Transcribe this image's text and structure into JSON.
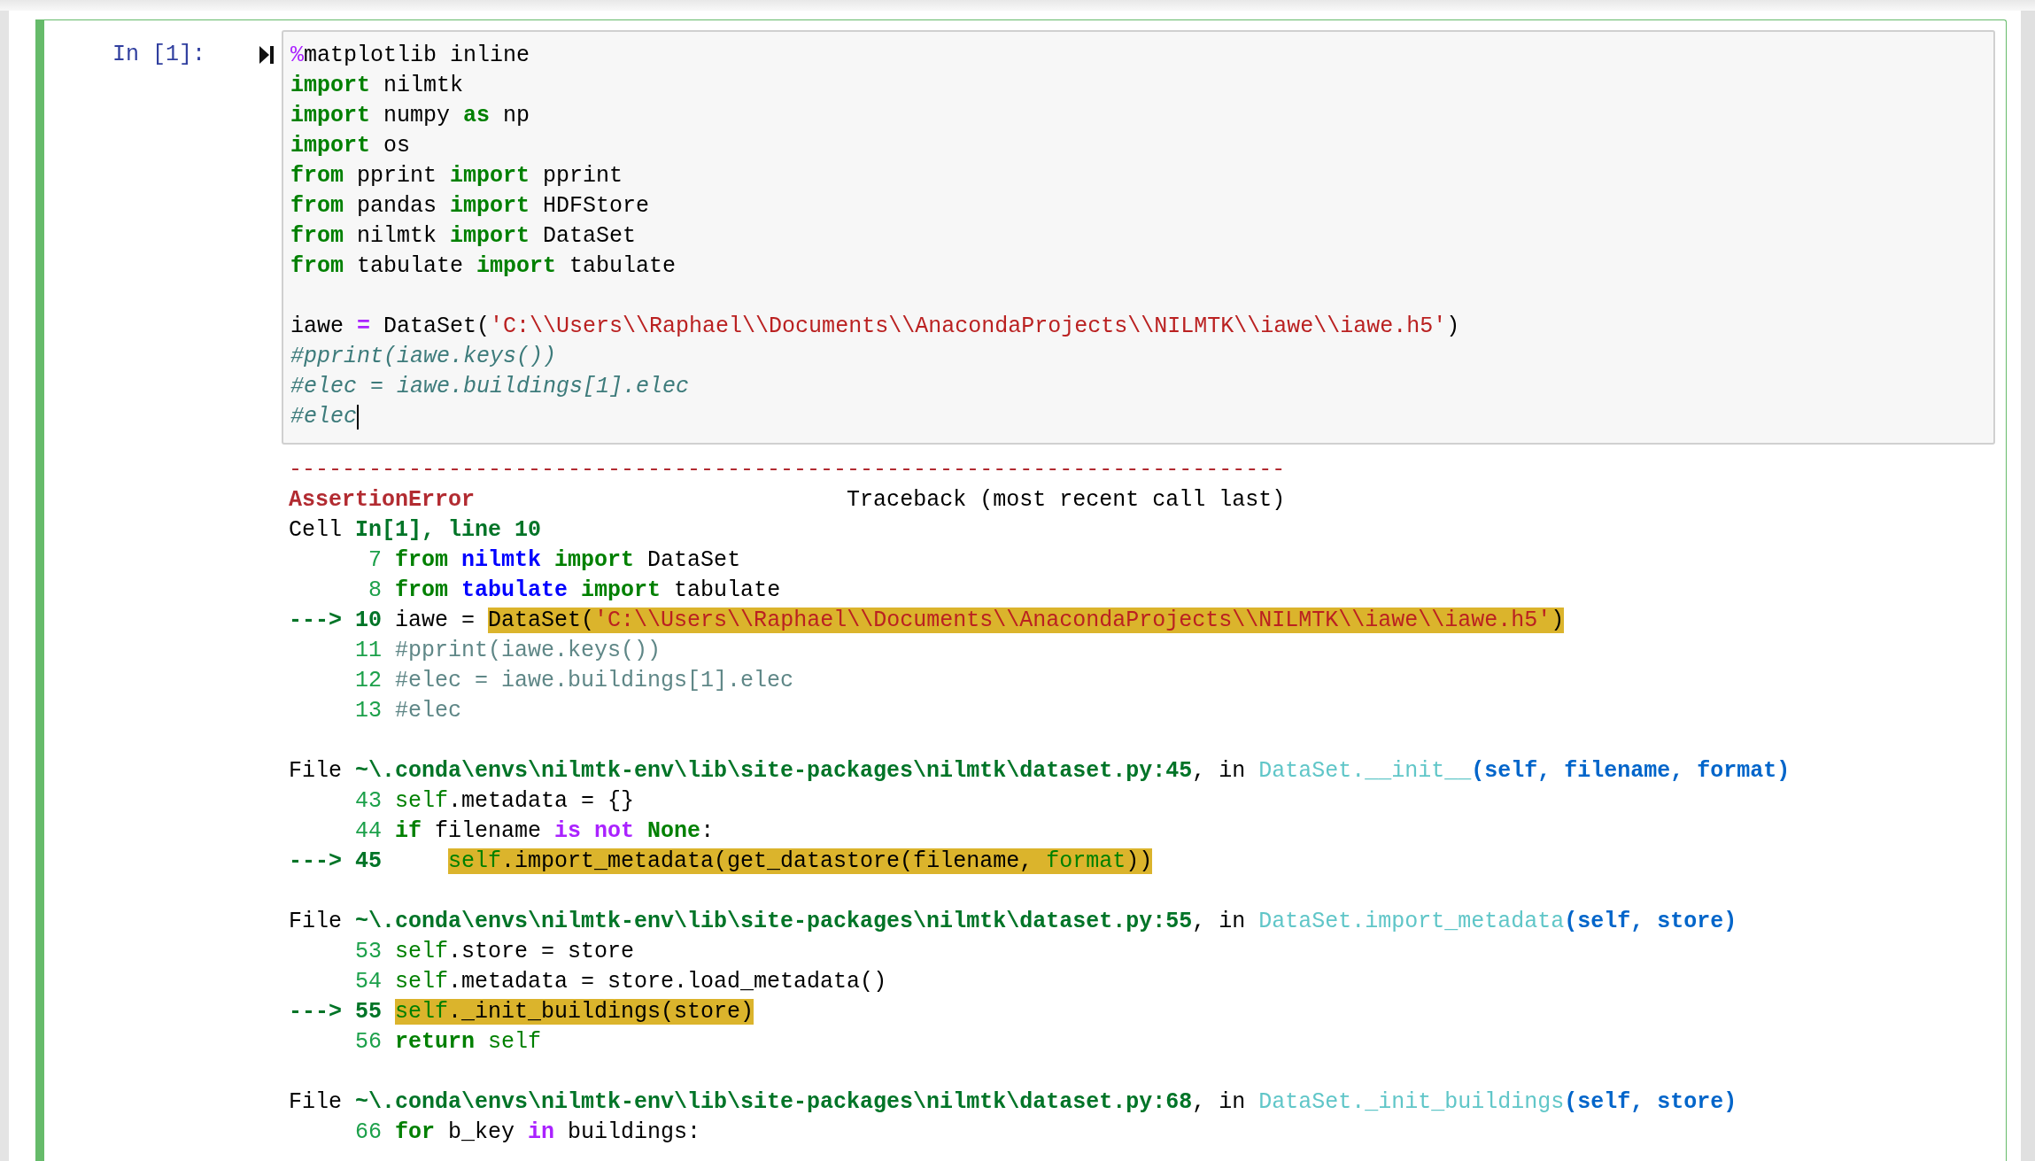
{
  "cell": {
    "prompt": "In [1]:",
    "input": {
      "blocks": [
        {
          "lines": [
            {
              "tokens": [
                {
                  "text": "%",
                  "kind": "magic"
                },
                {
                  "text": "matplotlib inline",
                  "kind": "plain"
                }
              ]
            },
            {
              "tokens": [
                {
                  "text": "import",
                  "kind": "kw"
                },
                {
                  "text": " nilmtk",
                  "kind": "plain"
                }
              ]
            },
            {
              "tokens": [
                {
                  "text": "import",
                  "kind": "kw"
                },
                {
                  "text": " numpy ",
                  "kind": "plain"
                },
                {
                  "text": "as",
                  "kind": "kw"
                },
                {
                  "text": " np",
                  "kind": "plain"
                }
              ]
            },
            {
              "tokens": [
                {
                  "text": "import",
                  "kind": "kw"
                },
                {
                  "text": " os",
                  "kind": "plain"
                }
              ]
            },
            {
              "tokens": [
                {
                  "text": "from",
                  "kind": "kw"
                },
                {
                  "text": " pprint ",
                  "kind": "plain"
                },
                {
                  "text": "import",
                  "kind": "kw"
                },
                {
                  "text": " pprint",
                  "kind": "plain"
                }
              ]
            },
            {
              "tokens": [
                {
                  "text": "from",
                  "kind": "kw"
                },
                {
                  "text": " pandas ",
                  "kind": "plain"
                },
                {
                  "text": "import",
                  "kind": "kw"
                },
                {
                  "text": " HDFStore",
                  "kind": "plain"
                }
              ]
            },
            {
              "tokens": [
                {
                  "text": "from",
                  "kind": "kw"
                },
                {
                  "text": " nilmtk ",
                  "kind": "plain"
                },
                {
                  "text": "import",
                  "kind": "kw"
                },
                {
                  "text": " DataSet",
                  "kind": "plain"
                }
              ]
            },
            {
              "tokens": [
                {
                  "text": "from",
                  "kind": "kw"
                },
                {
                  "text": " tabulate ",
                  "kind": "plain"
                },
                {
                  "text": "import",
                  "kind": "kw"
                },
                {
                  "text": " tabulate",
                  "kind": "plain"
                }
              ]
            }
          ]
        },
        {
          "lines": [
            {
              "tokens": [
                {
                  "text": "iawe ",
                  "kind": "plain"
                },
                {
                  "text": "=",
                  "kind": "op"
                },
                {
                  "text": " DataSet(",
                  "kind": "plain"
                },
                {
                  "text": "'C:\\\\Users\\\\Raphael\\\\Documents\\\\AnacondaProjects\\\\NILMTK\\\\iawe\\\\iawe.h5'",
                  "kind": "str"
                },
                {
                  "text": ")",
                  "kind": "plain"
                }
              ]
            },
            {
              "tokens": [
                {
                  "text": "#pprint(iawe.keys())",
                  "kind": "comment"
                }
              ]
            },
            {
              "tokens": [
                {
                  "text": "#elec = iawe.buildings[1].elec",
                  "kind": "comment"
                }
              ]
            },
            {
              "tokens": [
                {
                  "text": "#elec",
                  "kind": "comment"
                }
              ],
              "cursor": true
            }
          ]
        }
      ]
    },
    "output": {
      "blocks": [
        {
          "lines": [
            {
              "tokens": [
                {
                  "text": "---------------------------------------------------------------------------",
                  "kind": "err"
                }
              ]
            },
            {
              "tokens": [
                {
                  "text": "AssertionError",
                  "kind": "ename"
                },
                {
                  "text": "                            Traceback (most recent call last)",
                  "kind": "plain"
                }
              ]
            },
            {
              "tokens": [
                {
                  "text": "Cell ",
                  "kind": "plain"
                },
                {
                  "text": "In[1], line 10",
                  "kind": "path"
                }
              ]
            },
            {
              "tokens": [
                {
                  "text": "      7 ",
                  "kind": "lineno"
                },
                {
                  "text": "from",
                  "kind": "kw"
                },
                {
                  "text": " nilmtk",
                  "kind": "module"
                },
                {
                  "text": " import",
                  "kind": "kw"
                },
                {
                  "text": " DataSet",
                  "kind": "plain"
                }
              ]
            },
            {
              "tokens": [
                {
                  "text": "      8 ",
                  "kind": "lineno"
                },
                {
                  "text": "from",
                  "kind": "kw"
                },
                {
                  "text": " tabulate",
                  "kind": "module"
                },
                {
                  "text": " import",
                  "kind": "kw"
                },
                {
                  "text": " tabulate",
                  "kind": "plain"
                }
              ]
            },
            {
              "tokens": [
                {
                  "text": "---> 10 ",
                  "kind": "arrow"
                },
                {
                  "text": "iawe = ",
                  "kind": "plain"
                }
              ],
              "highlight": [
                {
                  "text": "DataSet(",
                  "kind": "plain"
                },
                {
                  "text": "'C:\\\\Users\\\\Raphael\\\\Documents\\\\AnacondaProjects\\\\NILMTK\\\\iawe\\\\iawe.h5'",
                  "kind": "str"
                },
                {
                  "text": ")",
                  "kind": "plain"
                }
              ]
            },
            {
              "tokens": [
                {
                  "text": "     11 ",
                  "kind": "lineno"
                },
                {
                  "text": "#pprint(iawe.keys())",
                  "kind": "tbcomment"
                }
              ]
            },
            {
              "tokens": [
                {
                  "text": "     12 ",
                  "kind": "lineno"
                },
                {
                  "text": "#elec = iawe.buildings[1].elec",
                  "kind": "tbcomment"
                }
              ]
            },
            {
              "tokens": [
                {
                  "text": "     13 ",
                  "kind": "lineno"
                },
                {
                  "text": "#elec",
                  "kind": "tbcomment"
                }
              ]
            }
          ]
        },
        {
          "lines": [
            {
              "tokens": [
                {
                  "text": "File ",
                  "kind": "plain"
                },
                {
                  "text": "~\\.conda\\envs\\nilmtk-env\\lib\\site-packages\\nilmtk\\dataset.py:45",
                  "kind": "path"
                },
                {
                  "text": ", in ",
                  "kind": "plain"
                },
                {
                  "text": "DataSet.__init__",
                  "kind": "func"
                },
                {
                  "text": "(self, filename, format)",
                  "kind": "args"
                }
              ]
            },
            {
              "tokens": [
                {
                  "text": "     43 ",
                  "kind": "lineno"
                },
                {
                  "text": "self",
                  "kind": "builtin"
                },
                {
                  "text": ".metadata = {}",
                  "kind": "plain"
                }
              ]
            },
            {
              "tokens": [
                {
                  "text": "     44 ",
                  "kind": "lineno"
                },
                {
                  "text": "if",
                  "kind": "kw"
                },
                {
                  "text": " filename ",
                  "kind": "plain"
                },
                {
                  "text": "is",
                  "kind": "op"
                },
                {
                  "text": " not",
                  "kind": "op"
                },
                {
                  "text": " None",
                  "kind": "kw"
                },
                {
                  "text": ":",
                  "kind": "plain"
                }
              ]
            },
            {
              "tokens": [
                {
                  "text": "---> 45     ",
                  "kind": "arrow"
                }
              ],
              "highlight": [
                {
                  "text": "self",
                  "kind": "builtin"
                },
                {
                  "text": ".import_metadata(get_datastore(filename, ",
                  "kind": "plain"
                },
                {
                  "text": "format",
                  "kind": "builtin"
                },
                {
                  "text": "))",
                  "kind": "plain"
                }
              ]
            }
          ]
        },
        {
          "lines": [
            {
              "tokens": [
                {
                  "text": "File ",
                  "kind": "plain"
                },
                {
                  "text": "~\\.conda\\envs\\nilmtk-env\\lib\\site-packages\\nilmtk\\dataset.py:55",
                  "kind": "path"
                },
                {
                  "text": ", in ",
                  "kind": "plain"
                },
                {
                  "text": "DataSet.import_metadata",
                  "kind": "func"
                },
                {
                  "text": "(self, store)",
                  "kind": "args"
                }
              ]
            },
            {
              "tokens": [
                {
                  "text": "     53 ",
                  "kind": "lineno"
                },
                {
                  "text": "self",
                  "kind": "builtin"
                },
                {
                  "text": ".store = store",
                  "kind": "plain"
                }
              ]
            },
            {
              "tokens": [
                {
                  "text": "     54 ",
                  "kind": "lineno"
                },
                {
                  "text": "self",
                  "kind": "builtin"
                },
                {
                  "text": ".metadata = store.load_metadata()",
                  "kind": "plain"
                }
              ]
            },
            {
              "tokens": [
                {
                  "text": "---> 55 ",
                  "kind": "arrow"
                }
              ],
              "highlight": [
                {
                  "text": "self",
                  "kind": "builtin"
                },
                {
                  "text": "._init_buildings(store)",
                  "kind": "plain"
                }
              ]
            },
            {
              "tokens": [
                {
                  "text": "     56 ",
                  "kind": "lineno"
                },
                {
                  "text": "return",
                  "kind": "kw"
                },
                {
                  "text": " self",
                  "kind": "builtin"
                }
              ]
            }
          ]
        },
        {
          "lines": [
            {
              "tokens": [
                {
                  "text": "File ",
                  "kind": "plain"
                },
                {
                  "text": "~\\.conda\\envs\\nilmtk-env\\lib\\site-packages\\nilmtk\\dataset.py:68",
                  "kind": "path"
                },
                {
                  "text": ", in ",
                  "kind": "plain"
                },
                {
                  "text": "DataSet._init_buildings",
                  "kind": "func"
                },
                {
                  "text": "(self, store)",
                  "kind": "args"
                }
              ]
            },
            {
              "tokens": [
                {
                  "text": "     66 ",
                  "kind": "lineno"
                },
                {
                  "text": "for",
                  "kind": "kw"
                },
                {
                  "text": " b_key ",
                  "kind": "plain"
                },
                {
                  "text": "in",
                  "kind": "op"
                },
                {
                  "text": " buildings:",
                  "kind": "plain"
                }
              ]
            }
          ]
        }
      ]
    }
  }
}
